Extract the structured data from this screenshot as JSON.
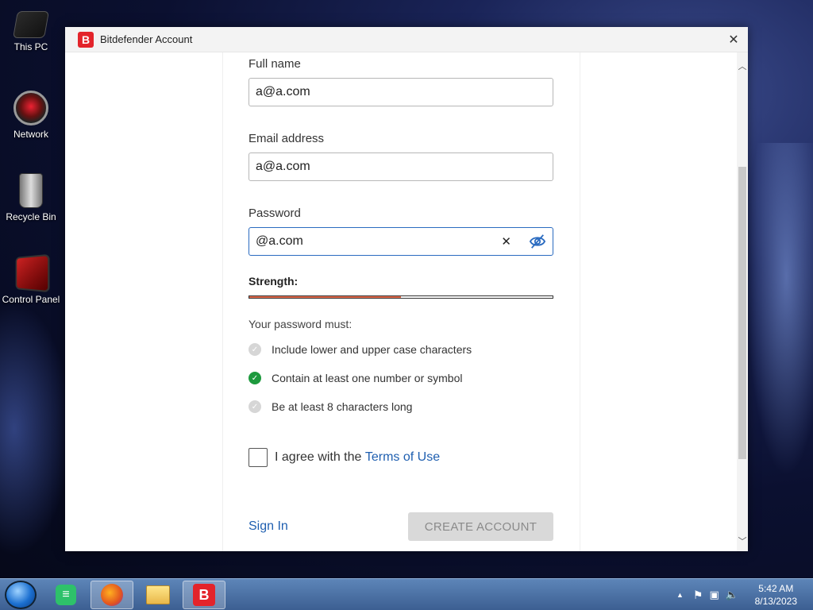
{
  "desktop": {
    "icons": [
      {
        "label": "This PC"
      },
      {
        "label": "Network"
      },
      {
        "label": "Recycle Bin"
      },
      {
        "label": "Control Panel"
      }
    ]
  },
  "window": {
    "logo_letter": "B",
    "title": "Bitdefender Account",
    "close_symbol": "✕"
  },
  "form": {
    "full_name_label": "Full name",
    "full_name_value": "a@a.com",
    "email_label": "Email address",
    "email_value": "a@a.com",
    "password_label": "Password",
    "password_value": "@a.com",
    "clear_symbol": "✕",
    "strength_label": "Strength:",
    "strength_fraction": 0.5,
    "strength_color": "#e56a4b",
    "requirements_heading": "Your password must:",
    "requirements": [
      {
        "text": "Include lower and upper case characters",
        "met": false
      },
      {
        "text": "Contain at least one number or symbol",
        "met": true
      },
      {
        "text": "Be at least 8 characters long",
        "met": false
      }
    ],
    "agree_prefix": "I agree with the ",
    "agree_link": "Terms of Use",
    "agree_checked": false,
    "signin_label": "Sign In",
    "create_label": "CREATE ACCOUNT"
  },
  "taskbar": {
    "bitdefender_letter": "B",
    "time": "5:42 AM",
    "date": "8/13/2023"
  },
  "colors": {
    "accent_link": "#1f5fb0",
    "brand": "#e3242b",
    "check_ok": "#1e9a3e"
  }
}
